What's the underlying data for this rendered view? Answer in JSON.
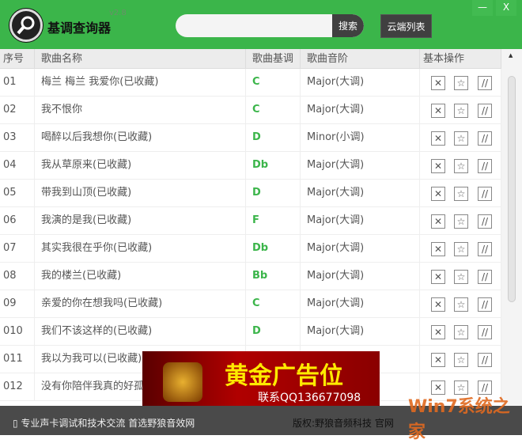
{
  "app": {
    "title": "基调查询器",
    "version": "v2.8",
    "search_placeholder": "",
    "search_button": "搜索",
    "cloud_button": "云端列表",
    "minimize": "—",
    "close": "X"
  },
  "columns": [
    "序号",
    "歌曲名称",
    "歌曲基调",
    "歌曲音阶",
    "基本操作"
  ],
  "rows": [
    {
      "no": "01",
      "name": "梅兰 梅兰 我爱你(已收藏)",
      "key": "C",
      "scale": "Major(大调)"
    },
    {
      "no": "02",
      "name": "我不恨你",
      "key": "C",
      "scale": "Major(大调)"
    },
    {
      "no": "03",
      "name": "喝醉以后我想你(已收藏)",
      "key": "D",
      "scale": "Minor(小调)"
    },
    {
      "no": "04",
      "name": "我从草原来(已收藏)",
      "key": "Db",
      "scale": "Major(大调)"
    },
    {
      "no": "05",
      "name": "带我到山顶(已收藏)",
      "key": "D",
      "scale": "Major(大调)"
    },
    {
      "no": "06",
      "name": "我演的是我(已收藏)",
      "key": "F",
      "scale": "Major(大调)"
    },
    {
      "no": "07",
      "name": "其实我很在乎你(已收藏)",
      "key": "Db",
      "scale": "Major(大调)"
    },
    {
      "no": "08",
      "name": "我的楼兰(已收藏)",
      "key": "Bb",
      "scale": "Major(大调)"
    },
    {
      "no": "09",
      "name": "亲爱的你在想我吗(已收藏)",
      "key": "C",
      "scale": "Major(大调)"
    },
    {
      "no": "010",
      "name": "我们不该这样的(已收藏)",
      "key": "D",
      "scale": "Major(大调)"
    },
    {
      "no": "011",
      "name": "我以为我可以(已收藏)",
      "key": "",
      "scale": ""
    },
    {
      "no": "012",
      "name": "没有你陪伴我真的好孤单",
      "key": "",
      "scale": ""
    }
  ],
  "ops": {
    "delete": "✕",
    "favorite": "☆",
    "edit": "//"
  },
  "ad": {
    "title": "黄金广告位",
    "contact": "联系QQ136677098"
  },
  "footer": {
    "left": "专业声卡调试和技术交流 首选野狼音效网",
    "right": "版权:野狼音频科技 官网"
  },
  "watermark": "Win7系统之家",
  "colors": {
    "header": "#3bb54a",
    "key": "#3bb54a",
    "footer": "#4a4a4a"
  }
}
